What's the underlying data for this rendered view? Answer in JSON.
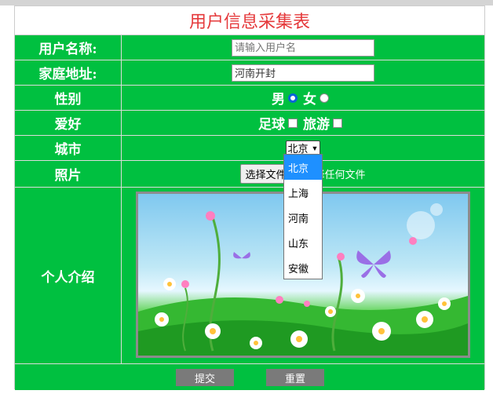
{
  "title": "用户信息采集表",
  "fields": {
    "username": {
      "label": "用户名称:",
      "placeholder": "请输入用户名",
      "value": ""
    },
    "address": {
      "label": "家庭地址:",
      "value": "河南开封"
    },
    "gender": {
      "label": "性别",
      "options": [
        "男",
        "女"
      ],
      "selected": "男"
    },
    "hobby": {
      "label": "爱好",
      "options": [
        "足球",
        "旅游"
      ]
    },
    "city": {
      "label": "城市",
      "selected": "北京",
      "options": [
        "北京",
        "上海",
        "河南",
        "山东",
        "安徽"
      ]
    },
    "photo": {
      "label": "照片",
      "button": "选择文件",
      "status": "未选择任何文件"
    },
    "intro": {
      "label": "个人介绍"
    }
  },
  "buttons": {
    "submit": "提交",
    "reset": "重置"
  },
  "colors": {
    "background": "#00c040",
    "title": "#e5393b",
    "button": "#7a7a7a",
    "selected_option": "#1e90ff"
  }
}
